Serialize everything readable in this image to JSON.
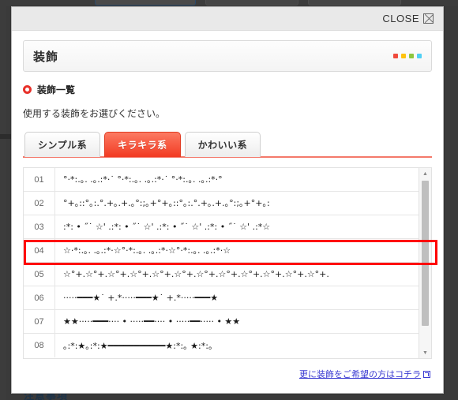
{
  "window": {
    "close_label": "CLOSE",
    "close_icon": "close-box-icon"
  },
  "panel": {
    "title": "装飾",
    "dot_colors": [
      "#f04a3c",
      "#ffc20e",
      "#8dc63f",
      "#4fd0f5"
    ]
  },
  "section": {
    "heading": "装飾一覧",
    "heading_icon": "ring-bullet-icon",
    "subtitle": "使用する装飾をお選びください。"
  },
  "tabs": [
    {
      "label": "シンプル系",
      "active": false
    },
    {
      "label": "キラキラ系",
      "active": true
    },
    {
      "label": "かわいい系",
      "active": false
    }
  ],
  "decorations": [
    {
      "num": "01",
      "pattern": "°·*:.｡. .｡.:*·˙ °·*:.｡. .｡.:*·˙ °·*:.｡. .｡.:*·°"
    },
    {
      "num": "02",
      "pattern": "°+｡::°｡:.°.+｡.+.｡°:;｡+°+｡::°｡:.°.+｡.+.｡°:;｡+°+｡:"
    },
    {
      "num": "03",
      "pattern": ":*: • ˝˙ ☆' .:*: • ˝˙ ☆' .:*: • ˝˙ ☆' .:*: • ˝˙ ☆' .:*☆"
    },
    {
      "num": "04",
      "pattern": "☆·*:.｡. .｡.:*·☆°·*:.｡. .｡.:*·☆°·*:.｡. .｡.:*·☆",
      "highlighted": true
    },
    {
      "num": "05",
      "pattern": "☆°+.☆°+.☆°+.☆°+.☆°+.☆°+.☆°+.☆°+.☆°+.☆°+.☆°+.☆°+."
    },
    {
      "num": "06",
      "pattern": "·····━━━★˙ +.*·····━━━★˙ +.*·····━━━★"
    },
    {
      "num": "07",
      "pattern": "★★·····━━━···· • ·····━━···· • ·····━━····· • ★★"
    },
    {
      "num": "08",
      "pattern": "｡:*:★｡:*:★━━━━━━━━━━━★:*:｡ ★:*:｡"
    }
  ],
  "scrollbar": {
    "up_arrow": "scroll-up-arrow-icon",
    "down_arrow": "scroll-down-arrow-icon"
  },
  "footer": {
    "link_text": "更に装飾をご希望の方はコチラ",
    "link_icon": "external-link-icon"
  },
  "background": {
    "partial_heading": "注意事項"
  }
}
